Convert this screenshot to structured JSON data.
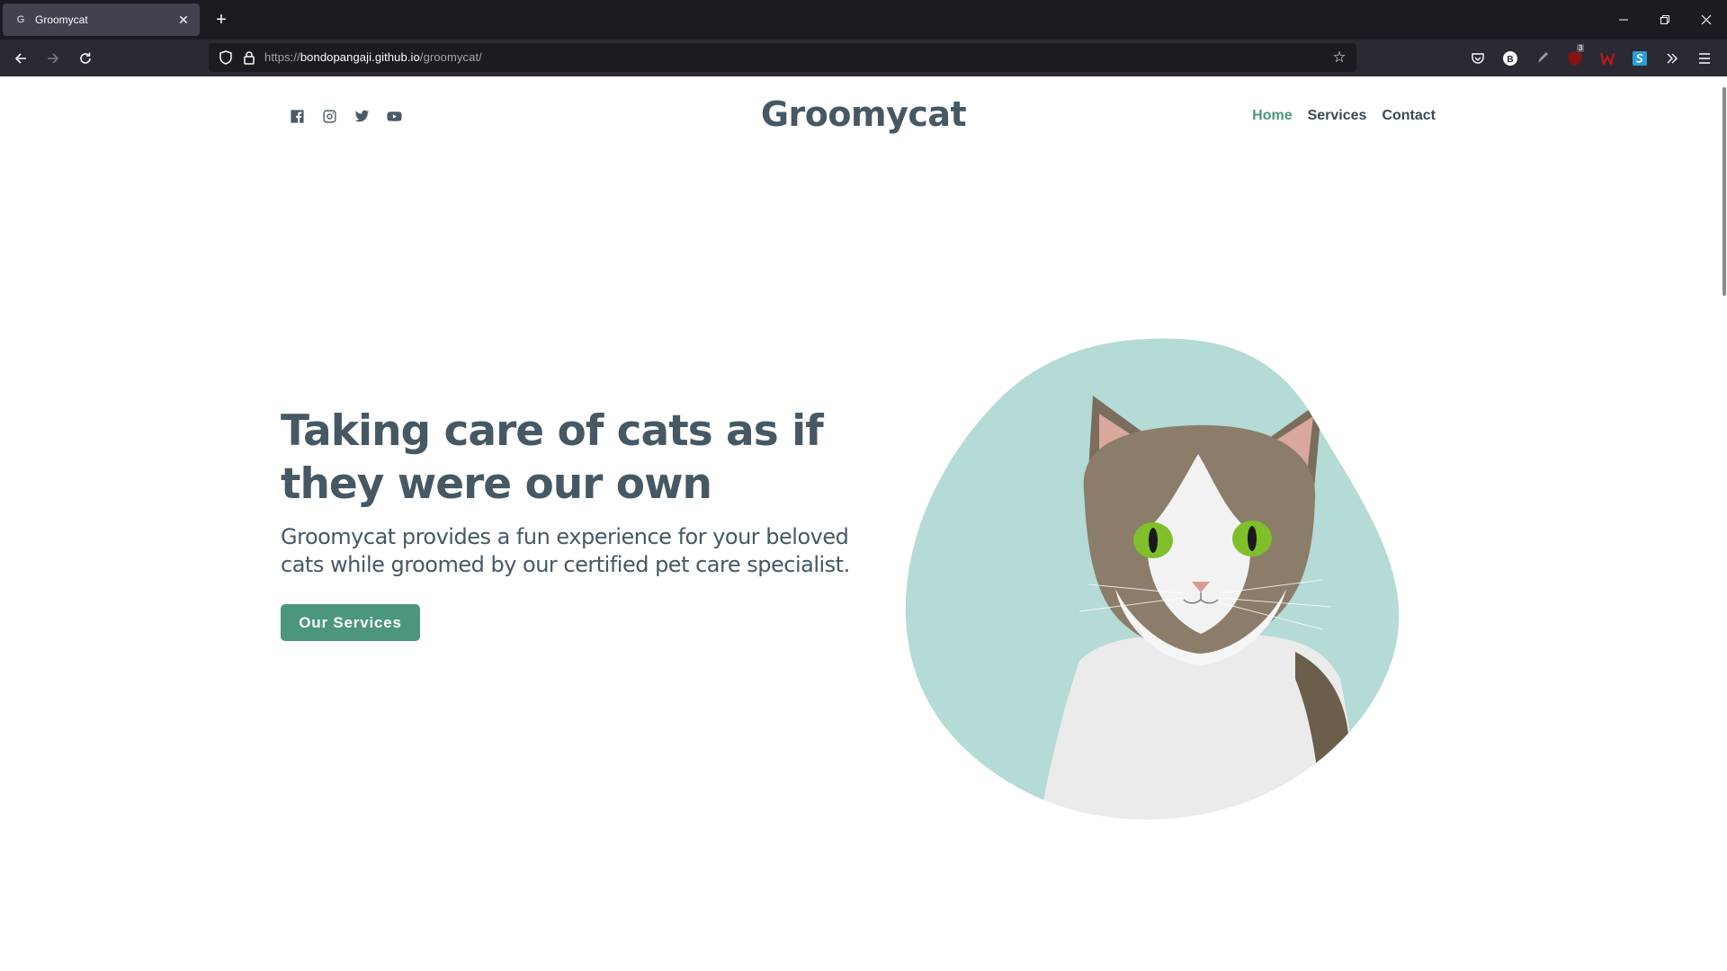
{
  "browser": {
    "tab_title": "Groomycat",
    "tab_favicon": "G",
    "url_prefix": "https://",
    "url_host": "bondopangaji.github.io",
    "url_path": "/groomycat/",
    "extension_badge": "3",
    "ext_b_letter": "B"
  },
  "site": {
    "logo": "Groomycat",
    "social_icons": [
      "facebook-icon",
      "instagram-icon",
      "twitter-icon",
      "youtube-icon"
    ],
    "nav": {
      "home": "Home",
      "services": "Services",
      "contact": "Contact"
    },
    "hero": {
      "title": "Taking care of cats as if they were our own",
      "subtitle": "Groomycat provides a fun experience for your beloved cats while groomed by our certified pet care specialist.",
      "cta": "Our Services"
    },
    "colors": {
      "accent": "#4c967d",
      "text": "#465863",
      "blob": "#b4dbd6"
    }
  }
}
